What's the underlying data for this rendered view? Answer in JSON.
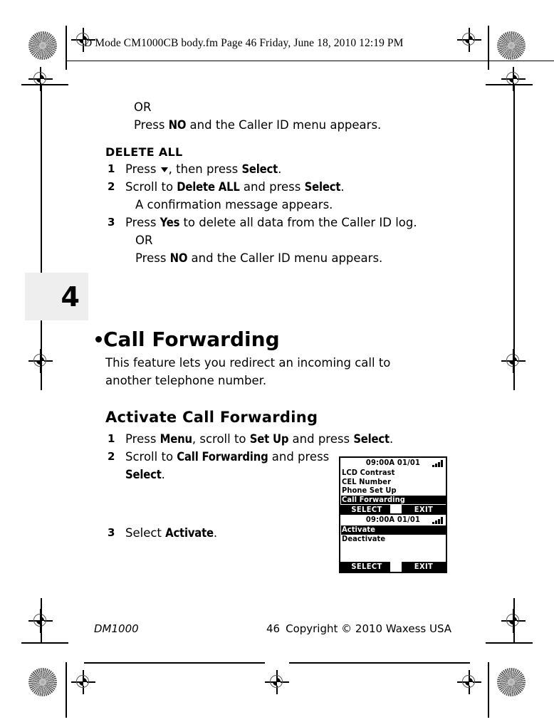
{
  "print_marks": {
    "file_header": "D Mode CM1000CB body.fm  Page 46  Friday, June 18, 2010  12:19 PM"
  },
  "chapter_tab": {
    "number": "4"
  },
  "content": {
    "or_1": "OR",
    "press_no_1": {
      "before": "Press ",
      "keyword": "NO",
      "after": " and the Caller ID menu appears."
    },
    "delete_all_heading": "DELETE ALL",
    "step_1": {
      "num": "1",
      "before": "Press ",
      "mid": ", then press ",
      "keyword": "Select",
      "after": "."
    },
    "step_2": {
      "num": "2",
      "before": "Scroll to ",
      "keyword": "Delete ALL",
      "mid": " and press ",
      "keyword2": "Select",
      "after": "."
    },
    "step_2_note": "A confirmation message appears.",
    "step_3": {
      "num": "3",
      "before": "Press ",
      "keyword": "Yes",
      "after": " to delete all data from the Caller ID log."
    },
    "or_2": "OR",
    "press_no_2": {
      "before": "Press ",
      "keyword": "NO",
      "after": " and the Caller ID menu appears."
    },
    "major_heading": "Call Forwarding",
    "intro_paragraph": "This feature lets you redirect an incoming call to another telephone number.",
    "sub_heading": "Activate Call Forwarding",
    "cf_step_1": {
      "num": "1",
      "before": "Press ",
      "keyword": "Menu",
      "mid": ", scroll to ",
      "keyword2": "Set Up",
      "mid2": " and press ",
      "keyword3": "Select",
      "after": "."
    },
    "cf_step_2": {
      "num": "2",
      "before": "Scroll to ",
      "keyword": "Call Forwarding",
      "mid": " and press ",
      "keyword2": "Select",
      "after": "."
    },
    "cf_step_3": {
      "num": "3",
      "before": "Select ",
      "keyword": "Activate",
      "after": "."
    }
  },
  "lcd_screens": [
    {
      "status": "09:00A 01/01",
      "signal_bars": 4,
      "rows": [
        {
          "label": "LCD Contrast",
          "selected": false
        },
        {
          "label": "CEL Number",
          "selected": false
        },
        {
          "label": "Phone Set Up",
          "selected": false
        },
        {
          "label": "Call Forwarding",
          "selected": true
        }
      ],
      "softkey_left": "SELECT",
      "softkey_right": "EXIT"
    },
    {
      "status": "09:00A 01/01",
      "signal_bars": 4,
      "rows": [
        {
          "label": "Activate",
          "selected": true
        },
        {
          "label": "Deactivate",
          "selected": false
        },
        {
          "label": "",
          "selected": false
        },
        {
          "label": "",
          "selected": false
        }
      ],
      "softkey_left": "SELECT",
      "softkey_right": "EXIT"
    }
  ],
  "footer": {
    "model": "DM1000",
    "page_number": "46",
    "copyright": "Copyright © 2010 Waxess USA"
  }
}
